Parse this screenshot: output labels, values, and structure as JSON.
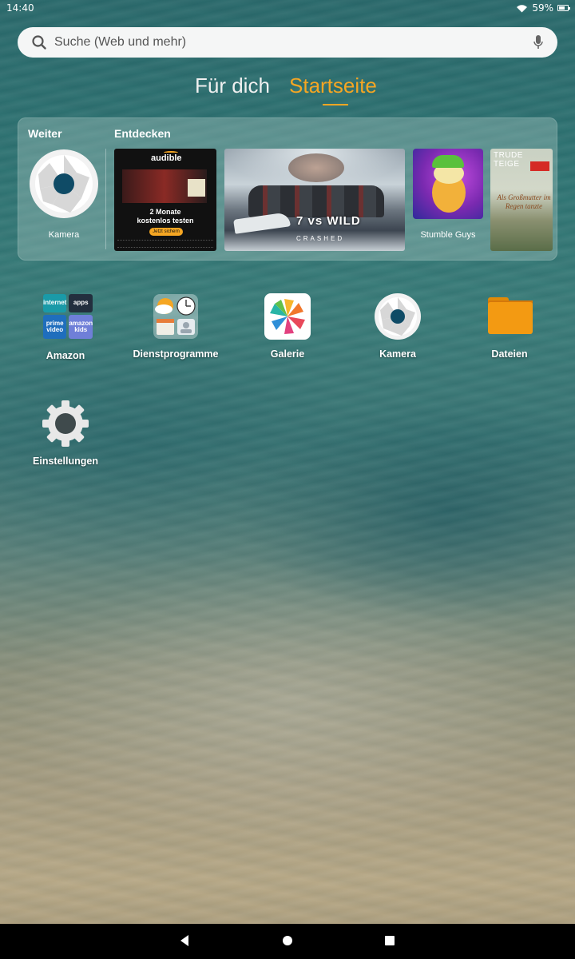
{
  "status_bar": {
    "time": "14:40",
    "battery": "59%"
  },
  "search": {
    "placeholder": "Suche (Web und mehr)"
  },
  "tabs": [
    {
      "label": "Für dich",
      "selected": false
    },
    {
      "label": "Startseite",
      "selected": true
    }
  ],
  "accent_color": "#f5a623",
  "panel": {
    "continue_label": "Weiter",
    "discover_label": "Entdecken",
    "continue_app": {
      "label": "Kamera",
      "icon": "camera-shutter-icon"
    },
    "discover_items": [
      {
        "kind": "audible-promo",
        "brand": "audible",
        "headline_1": "2 Monate",
        "headline_2": "kostenlos testen",
        "button": "Jetzt sichern"
      },
      {
        "kind": "tv-show",
        "title": "7 vs WILD",
        "subtitle": "CRASHED"
      },
      {
        "kind": "game",
        "label": "Stumble Guys"
      },
      {
        "kind": "book",
        "author_1": "TRUDE",
        "author_2": "TEIGE",
        "title": "Als Großmutter im Regen tanzte"
      }
    ]
  },
  "apps": [
    {
      "label": "Amazon",
      "icon": "amazon-folder-icon",
      "tiles": [
        "internet",
        "apps",
        "prime video",
        "amazon kids"
      ]
    },
    {
      "label": "Dienstprogramme",
      "icon": "utilities-folder-icon"
    },
    {
      "label": "Galerie",
      "icon": "gallery-pinwheel-icon"
    },
    {
      "label": "Kamera",
      "icon": "camera-shutter-icon"
    },
    {
      "label": "Dateien",
      "icon": "files-folder-icon"
    },
    {
      "label": "Einstellungen",
      "icon": "settings-gear-icon"
    }
  ],
  "nav": {
    "back": "back-icon",
    "home": "home-icon",
    "recents": "recents-icon"
  }
}
